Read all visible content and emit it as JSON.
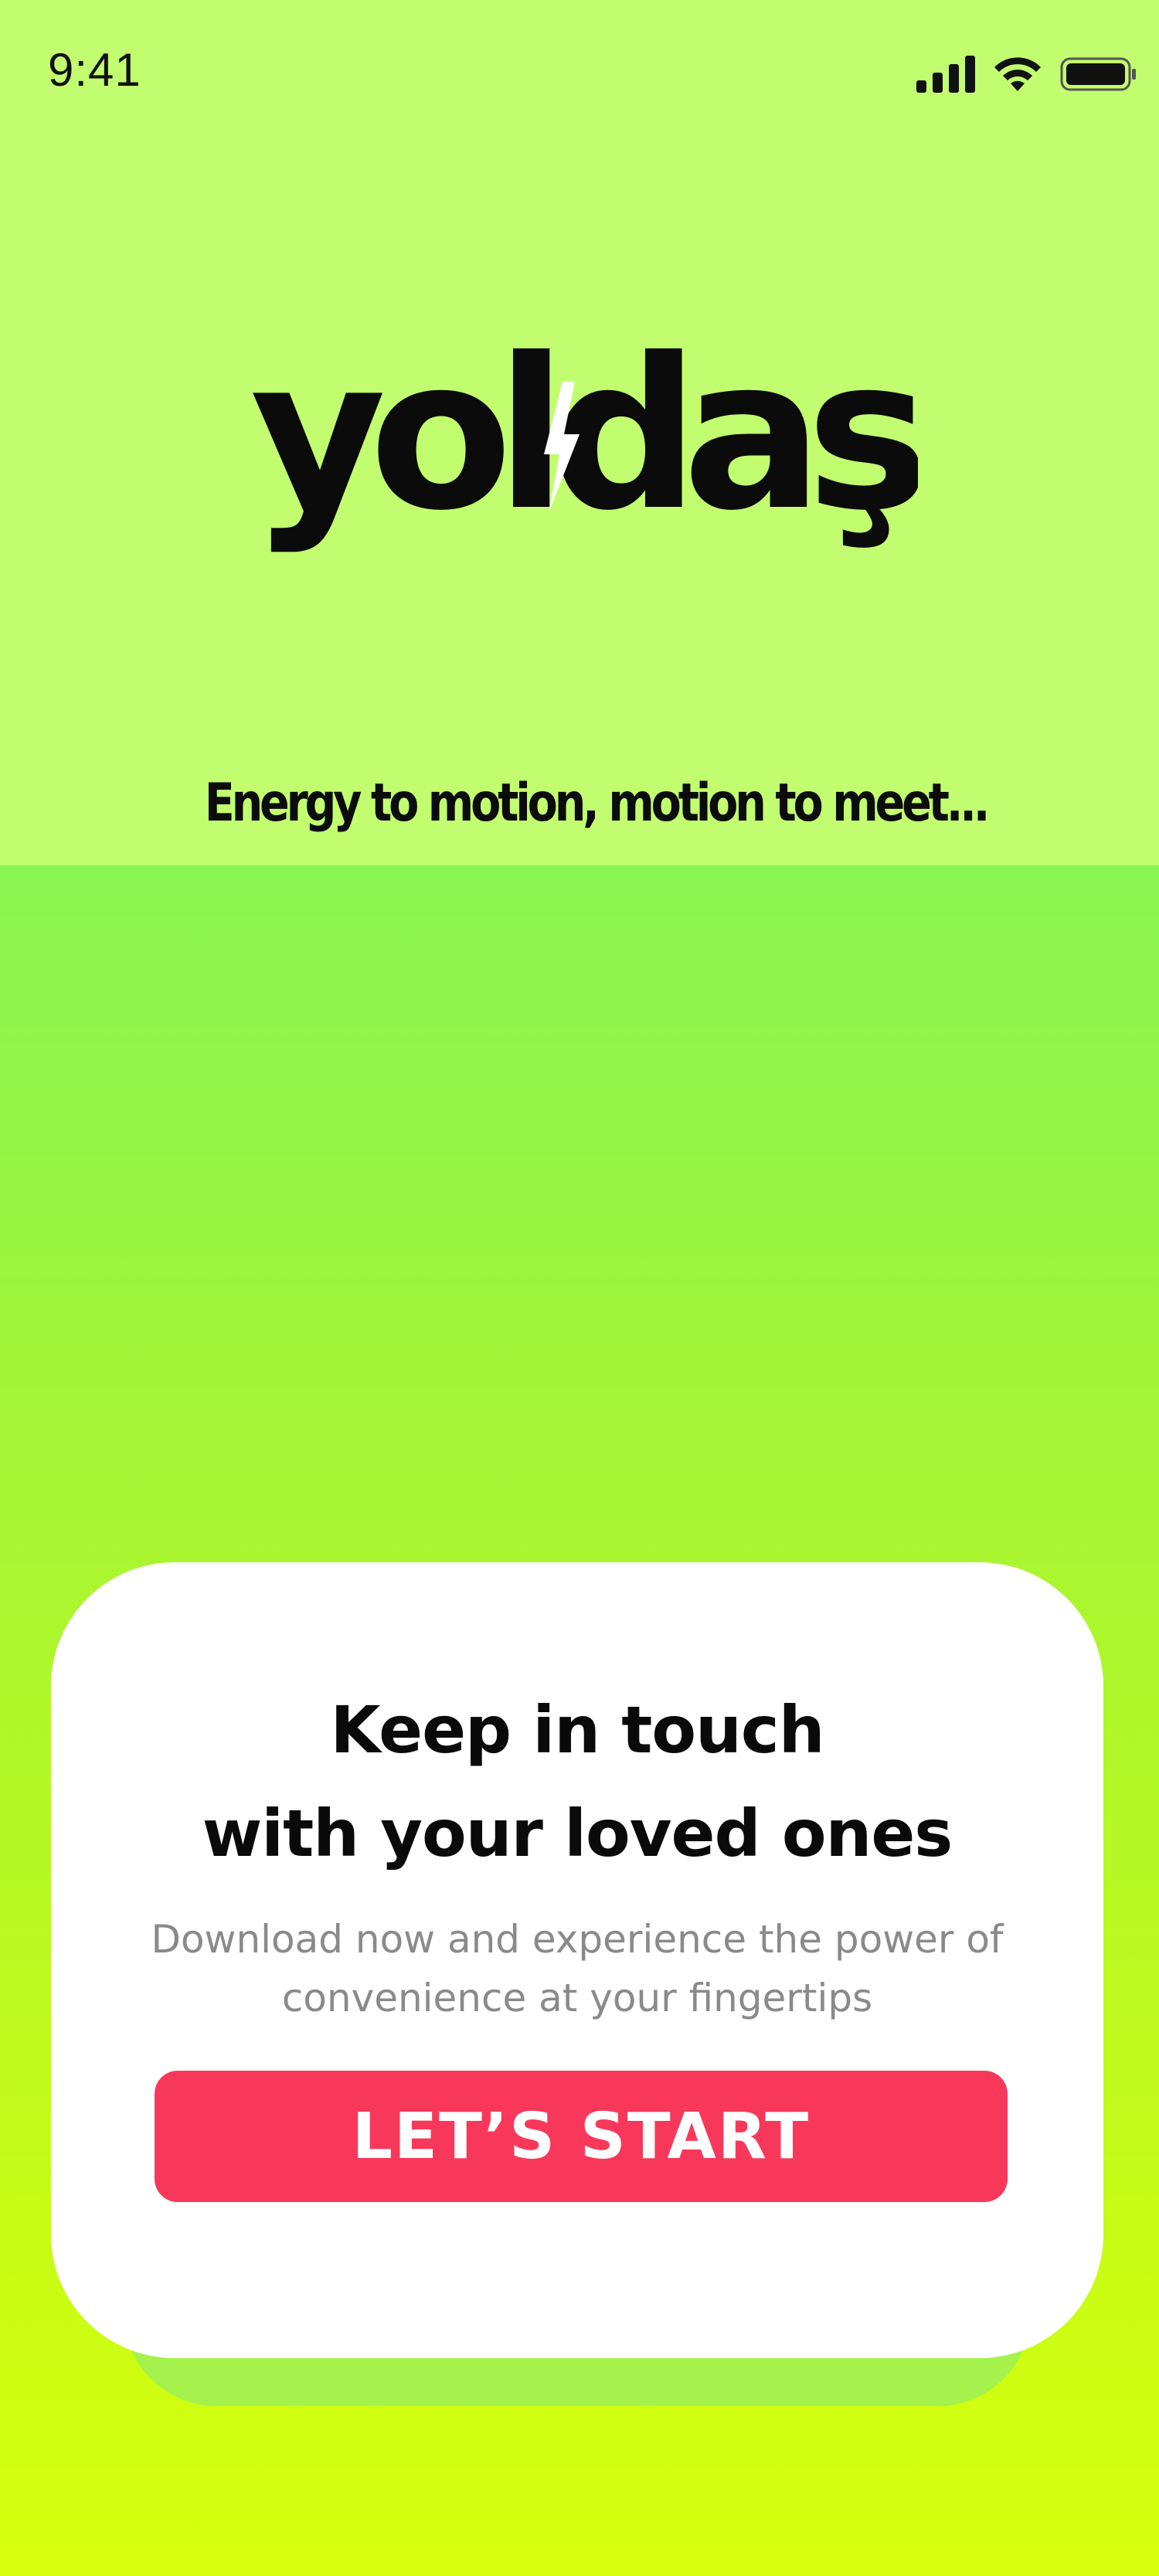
{
  "status_bar": {
    "time": "9:41",
    "icons": [
      "cellular-signal-icon",
      "wifi-icon",
      "battery-icon"
    ]
  },
  "logo": {
    "text": "yoldaş",
    "icon": "lightning-bolt-icon"
  },
  "tagline": "Energy to motion, motion to meet...",
  "card": {
    "title_lines": [
      "Keep in touch",
      "with your loved ones"
    ],
    "description_lines": [
      "Download now and experience the power of",
      "convenience at your fingertips"
    ],
    "button_label": "LET’S START"
  },
  "colors": {
    "top_background": "#c2fd6f",
    "gradient_top": "#89f552",
    "gradient_bottom": "#d8ff0b",
    "card_background": "#ffffff",
    "button_background": "#f8385a",
    "button_text": "#ffffff",
    "description_text": "#8a8a8a"
  }
}
